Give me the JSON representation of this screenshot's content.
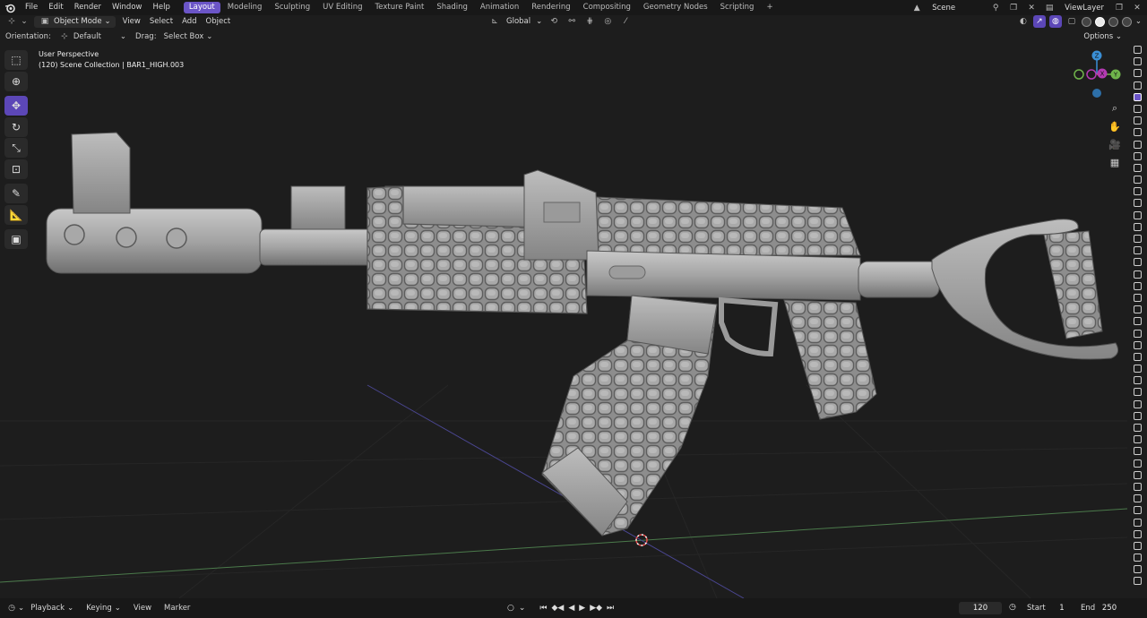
{
  "topbar": {
    "menus": [
      "File",
      "Edit",
      "Render",
      "Window",
      "Help"
    ],
    "workspaces": [
      {
        "label": "Layout",
        "active": true
      },
      {
        "label": "Modeling"
      },
      {
        "label": "Sculpting"
      },
      {
        "label": "UV Editing"
      },
      {
        "label": "Texture Paint"
      },
      {
        "label": "Shading"
      },
      {
        "label": "Animation"
      },
      {
        "label": "Rendering"
      },
      {
        "label": "Compositing"
      },
      {
        "label": "Geometry Nodes"
      },
      {
        "label": "Scripting"
      }
    ],
    "add_tab": "+",
    "scene": "Scene",
    "view_layer": "ViewLayer"
  },
  "header": {
    "mode": "Object Mode",
    "menus": [
      "View",
      "Select",
      "Add",
      "Object"
    ],
    "transform_orientation": "Global",
    "options_label": "Options"
  },
  "tool_settings": {
    "orientation_label": "Orientation:",
    "orientation_value": "Default",
    "drag_label": "Drag:",
    "drag_value": "Select Box"
  },
  "viewport": {
    "view_name": "User Perspective",
    "collection_info": "(120) Scene Collection | BAR1_HIGH.003"
  },
  "gizmo": {
    "z_label": "Z",
    "y_label": "Y",
    "x_label": "X",
    "colors": {
      "x": "#e24a5c",
      "y": "#6fb34b",
      "z": "#3a8fd6",
      "bg": "#1d1d1d"
    }
  },
  "timeline": {
    "menus": [
      "Playback",
      "Keying",
      "View",
      "Marker"
    ],
    "current_frame": "120",
    "start_label": "Start",
    "start_value": "1",
    "end_label": "End",
    "end_value": "250"
  },
  "colors": {
    "accent": "#6b55c7",
    "background": "#1d1d1d",
    "header": "#181818",
    "model": "#a9a9a9"
  }
}
